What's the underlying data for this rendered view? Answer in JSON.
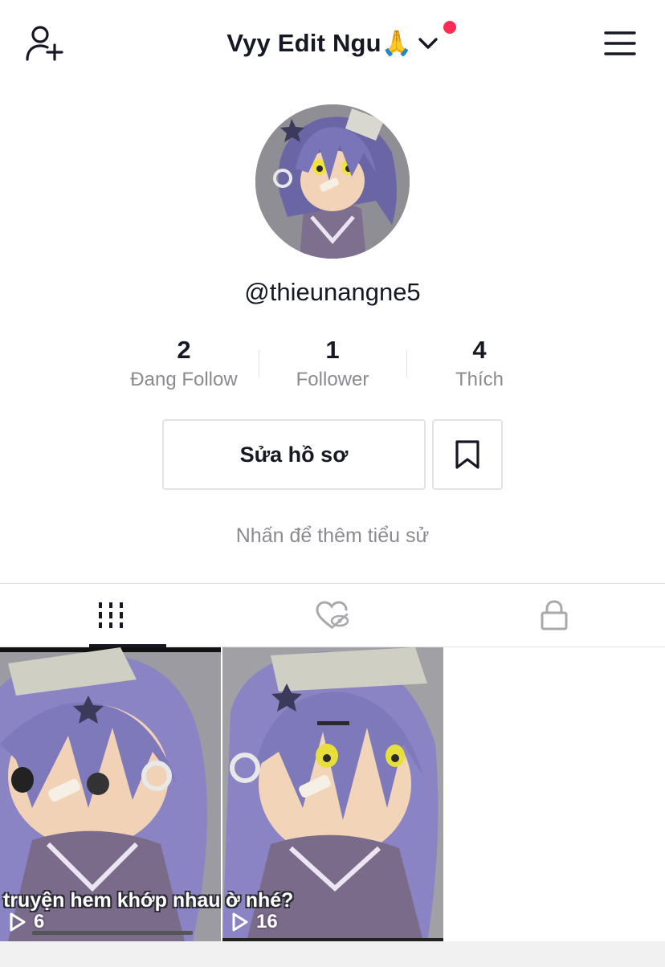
{
  "header": {
    "title": "Vyy Edit Ngu🙏",
    "add_user_icon": "add-user-icon",
    "menu_icon": "hamburger-menu-icon",
    "notification_dot_color": "#fe2c55"
  },
  "profile": {
    "username": "@thieunangne5",
    "bio_placeholder": "Nhấn để thêm tiểu sử",
    "edit_profile_label": "Sửa hồ sơ",
    "bookmark_icon": "bookmark-icon"
  },
  "stats": [
    {
      "value": "2",
      "label": "Đang Follow"
    },
    {
      "value": "1",
      "label": "Follower"
    },
    {
      "value": "4",
      "label": "Thích"
    }
  ],
  "tabs": [
    {
      "icon": "videos-grid-icon",
      "active": true
    },
    {
      "icon": "liked-hidden-icon",
      "active": false
    },
    {
      "icon": "lock-icon",
      "active": false
    }
  ],
  "videos": [
    {
      "caption": "truyện hem khớp nhau j",
      "plays": "6"
    },
    {
      "caption": "ờ nhé?",
      "plays": "16"
    }
  ]
}
